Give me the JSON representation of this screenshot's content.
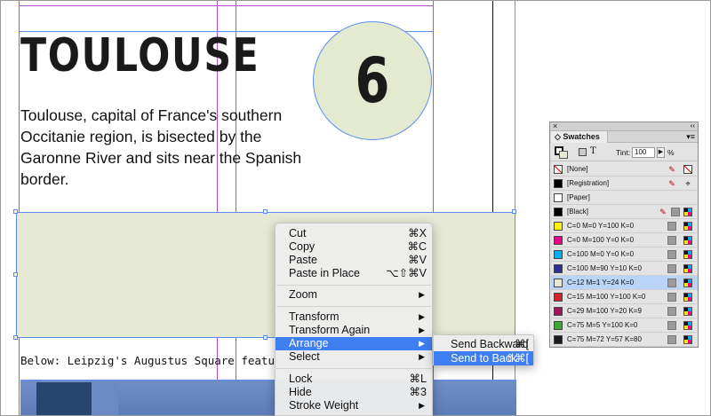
{
  "page": {
    "title": "TOULOUSE",
    "body": "Toulouse, capital of France's southern Occitanie region, is bisected by the Garonne River and sits near the Spanish border.",
    "badge_number": "6",
    "caption": "Below: Leipzig's Augustus Square features a striki"
  },
  "context_menu": {
    "items": [
      {
        "label": "Cut",
        "shortcut": "⌘X"
      },
      {
        "label": "Copy",
        "shortcut": "⌘C"
      },
      {
        "label": "Paste",
        "shortcut": "⌘V"
      },
      {
        "label": "Paste in Place",
        "shortcut": "⌥⇧⌘V"
      },
      {
        "label": "Zoom",
        "shortcut": "▶"
      },
      {
        "label": "Transform",
        "shortcut": "▶"
      },
      {
        "label": "Transform Again",
        "shortcut": "▶"
      },
      {
        "label": "Arrange",
        "shortcut": "▶"
      },
      {
        "label": "Select",
        "shortcut": "▶"
      },
      {
        "label": "Lock",
        "shortcut": "⌘L"
      },
      {
        "label": "Hide",
        "shortcut": "⌘3"
      },
      {
        "label": "Stroke Weight",
        "shortcut": "▶"
      }
    ],
    "highlighted": "Arrange"
  },
  "arrange_submenu": {
    "items": [
      {
        "label": "Send Backward",
        "shortcut": "⌘["
      },
      {
        "label": "Send to Back",
        "shortcut": "⇧⌘["
      }
    ],
    "highlighted": "Send to Back"
  },
  "swatches_panel": {
    "close_glyph": "×",
    "collapse_glyph": "‹‹",
    "tab_label": "Swatches",
    "menu_glyph": "▾≡",
    "t_glyph": "T",
    "tint_label": "Tint:",
    "tint_value": "100",
    "tint_arrow": "▶",
    "tint_unit": "%",
    "swatches": [
      {
        "name": "[None]",
        "color": "none"
      },
      {
        "name": "[Registration]",
        "color": "#000000"
      },
      {
        "name": "[Paper]",
        "color": "#ffffff"
      },
      {
        "name": "[Black]",
        "color": "#000000"
      },
      {
        "name": "C=0 M=0 Y=100 K=0",
        "color": "#fff200"
      },
      {
        "name": "C=0 M=100 Y=0 K=0",
        "color": "#ec008c"
      },
      {
        "name": "C=100 M=0 Y=0 K=0",
        "color": "#00aeef"
      },
      {
        "name": "C=100 M=90 Y=10 K=0",
        "color": "#2e3192"
      },
      {
        "name": "C=12 M=1 Y=24 K=0",
        "color": "#e4ead0"
      },
      {
        "name": "C=15 M=100 Y=100 K=0",
        "color": "#d2232a"
      },
      {
        "name": "C=29 M=100 Y=20 K=9",
        "color": "#a0175e"
      },
      {
        "name": "C=75 M=5 Y=100 K=0",
        "color": "#3aa935"
      },
      {
        "name": "C=75 M=72 Y=57 K=80",
        "color": "#1b1b22"
      }
    ],
    "selected_index": 8
  },
  "colors": {
    "accent_highlight": "#3e7ef0",
    "frame_fill": "#e6ead5",
    "guide_purple": "#b34fd1",
    "selection_blue": "#5b8cf0"
  }
}
